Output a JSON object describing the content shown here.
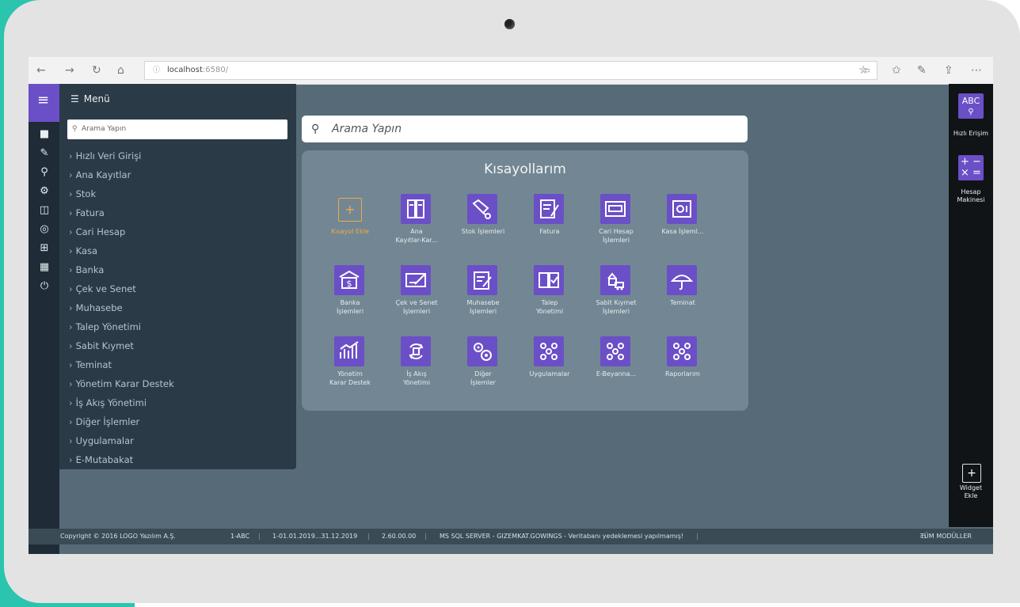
{
  "browser": {
    "url_host": "localhost",
    "url_port": ":6580/"
  },
  "menu": {
    "title": "Menü",
    "search_placeholder": "Arama Yapın",
    "items": [
      "Hızlı Veri Girişi",
      "Ana Kayıtlar",
      "Stok",
      "Fatura",
      "Cari Hesap",
      "Kasa",
      "Banka",
      "Çek ve Senet",
      "Muhasebe",
      "Talep Yönetimi",
      "Sabit Kıymet",
      "Teminat",
      "Yönetim Karar Destek",
      "İş Akış Yönetimi",
      "Diğer İşlemler",
      "Uygulamalar",
      "E-Mutabakat"
    ]
  },
  "main_search": {
    "placeholder": "Arama Yapın"
  },
  "shortcuts": {
    "title": "Kısayollarım",
    "tiles": [
      {
        "line1": "Kısayol Ekle",
        "line2": "",
        "icon": "add-icon"
      },
      {
        "line1": "Ana",
        "line2": "Kayıtlar-Kar...",
        "icon": "records-icon"
      },
      {
        "line1": "Stok İşlemleri",
        "line2": "",
        "icon": "stock-icon"
      },
      {
        "line1": "Fatura",
        "line2": "",
        "icon": "invoice-icon"
      },
      {
        "line1": "Cari Hesap",
        "line2": "İşlemleri",
        "icon": "account-icon"
      },
      {
        "line1": "Kasa İşleml...",
        "line2": "",
        "icon": "safe-icon"
      },
      {
        "line1": "Banka",
        "line2": "İşlemleri",
        "icon": "bank-icon"
      },
      {
        "line1": "Çek ve Senet",
        "line2": "İşlemleri",
        "icon": "cheque-icon"
      },
      {
        "line1": "Muhasebe",
        "line2": "İşlemleri",
        "icon": "accounting-icon"
      },
      {
        "line1": "Talep",
        "line2": "Yönetimi",
        "icon": "request-icon"
      },
      {
        "line1": "Sabit Kıymet",
        "line2": "İşlemleri",
        "icon": "asset-icon"
      },
      {
        "line1": "Teminat",
        "line2": "",
        "icon": "umbrella-icon"
      },
      {
        "line1": "Yönetim",
        "line2": "Karar Destek",
        "icon": "chart-icon"
      },
      {
        "line1": "İş Akış",
        "line2": "Yönetimi",
        "icon": "workflow-icon"
      },
      {
        "line1": "Diğer",
        "line2": "İşlemler",
        "icon": "gears-icon"
      },
      {
        "line1": "Uygulamalar",
        "line2": "",
        "icon": "dots-icon"
      },
      {
        "line1": "E-Beyanna...",
        "line2": "",
        "icon": "dots-icon"
      },
      {
        "line1": "Raporlarım",
        "line2": "",
        "icon": "dots-icon"
      }
    ]
  },
  "right_rail": {
    "quick_access_label": "Hızlı Erişim",
    "quick_access_icon_text": "ABC",
    "calc_label_1": "Hesap",
    "calc_label_2": "Makinesi",
    "widget_label_1": "Widget",
    "widget_label_2": "Ekle"
  },
  "status": {
    "copyright": "Copyright © 2016 LOGO Yazılım A.Ş.",
    "firm": "1-ABC",
    "period": "1-01.01.2019...31.12.2019",
    "version": "2.60.00.00",
    "server": "MS SQL SERVER - GIZEMKAT.GOWINGS - Veritabanı yedeklemesi yapılmamış!",
    "all_modules": "TÜM MODÜLLER"
  },
  "colors": {
    "accent": "#6b4fc7",
    "add_tile": "#f0a94a",
    "screen_bg": "#566b77",
    "menu_bg": "#2b3a47",
    "tablet_frame": "#e3e3e3",
    "teal": "#2bc4ae"
  }
}
